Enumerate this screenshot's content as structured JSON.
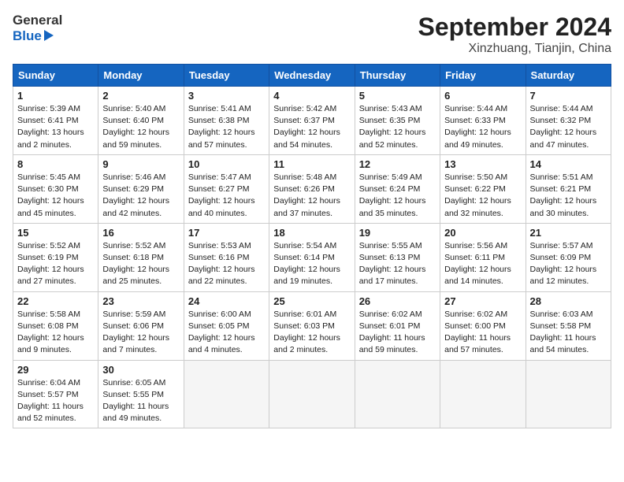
{
  "header": {
    "logo_general": "General",
    "logo_blue": "Blue",
    "title": "September 2024",
    "subtitle": "Xinzhuang, Tianjin, China"
  },
  "weekdays": [
    "Sunday",
    "Monday",
    "Tuesday",
    "Wednesday",
    "Thursday",
    "Friday",
    "Saturday"
  ],
  "weeks": [
    [
      {
        "day": "1",
        "sunrise": "5:39 AM",
        "sunset": "6:41 PM",
        "daylight": "13 hours and 2 minutes."
      },
      {
        "day": "2",
        "sunrise": "5:40 AM",
        "sunset": "6:40 PM",
        "daylight": "12 hours and 59 minutes."
      },
      {
        "day": "3",
        "sunrise": "5:41 AM",
        "sunset": "6:38 PM",
        "daylight": "12 hours and 57 minutes."
      },
      {
        "day": "4",
        "sunrise": "5:42 AM",
        "sunset": "6:37 PM",
        "daylight": "12 hours and 54 minutes."
      },
      {
        "day": "5",
        "sunrise": "5:43 AM",
        "sunset": "6:35 PM",
        "daylight": "12 hours and 52 minutes."
      },
      {
        "day": "6",
        "sunrise": "5:44 AM",
        "sunset": "6:33 PM",
        "daylight": "12 hours and 49 minutes."
      },
      {
        "day": "7",
        "sunrise": "5:44 AM",
        "sunset": "6:32 PM",
        "daylight": "12 hours and 47 minutes."
      }
    ],
    [
      {
        "day": "8",
        "sunrise": "5:45 AM",
        "sunset": "6:30 PM",
        "daylight": "12 hours and 45 minutes."
      },
      {
        "day": "9",
        "sunrise": "5:46 AM",
        "sunset": "6:29 PM",
        "daylight": "12 hours and 42 minutes."
      },
      {
        "day": "10",
        "sunrise": "5:47 AM",
        "sunset": "6:27 PM",
        "daylight": "12 hours and 40 minutes."
      },
      {
        "day": "11",
        "sunrise": "5:48 AM",
        "sunset": "6:26 PM",
        "daylight": "12 hours and 37 minutes."
      },
      {
        "day": "12",
        "sunrise": "5:49 AM",
        "sunset": "6:24 PM",
        "daylight": "12 hours and 35 minutes."
      },
      {
        "day": "13",
        "sunrise": "5:50 AM",
        "sunset": "6:22 PM",
        "daylight": "12 hours and 32 minutes."
      },
      {
        "day": "14",
        "sunrise": "5:51 AM",
        "sunset": "6:21 PM",
        "daylight": "12 hours and 30 minutes."
      }
    ],
    [
      {
        "day": "15",
        "sunrise": "5:52 AM",
        "sunset": "6:19 PM",
        "daylight": "12 hours and 27 minutes."
      },
      {
        "day": "16",
        "sunrise": "5:52 AM",
        "sunset": "6:18 PM",
        "daylight": "12 hours and 25 minutes."
      },
      {
        "day": "17",
        "sunrise": "5:53 AM",
        "sunset": "6:16 PM",
        "daylight": "12 hours and 22 minutes."
      },
      {
        "day": "18",
        "sunrise": "5:54 AM",
        "sunset": "6:14 PM",
        "daylight": "12 hours and 19 minutes."
      },
      {
        "day": "19",
        "sunrise": "5:55 AM",
        "sunset": "6:13 PM",
        "daylight": "12 hours and 17 minutes."
      },
      {
        "day": "20",
        "sunrise": "5:56 AM",
        "sunset": "6:11 PM",
        "daylight": "12 hours and 14 minutes."
      },
      {
        "day": "21",
        "sunrise": "5:57 AM",
        "sunset": "6:09 PM",
        "daylight": "12 hours and 12 minutes."
      }
    ],
    [
      {
        "day": "22",
        "sunrise": "5:58 AM",
        "sunset": "6:08 PM",
        "daylight": "12 hours and 9 minutes."
      },
      {
        "day": "23",
        "sunrise": "5:59 AM",
        "sunset": "6:06 PM",
        "daylight": "12 hours and 7 minutes."
      },
      {
        "day": "24",
        "sunrise": "6:00 AM",
        "sunset": "6:05 PM",
        "daylight": "12 hours and 4 minutes."
      },
      {
        "day": "25",
        "sunrise": "6:01 AM",
        "sunset": "6:03 PM",
        "daylight": "12 hours and 2 minutes."
      },
      {
        "day": "26",
        "sunrise": "6:02 AM",
        "sunset": "6:01 PM",
        "daylight": "11 hours and 59 minutes."
      },
      {
        "day": "27",
        "sunrise": "6:02 AM",
        "sunset": "6:00 PM",
        "daylight": "11 hours and 57 minutes."
      },
      {
        "day": "28",
        "sunrise": "6:03 AM",
        "sunset": "5:58 PM",
        "daylight": "11 hours and 54 minutes."
      }
    ],
    [
      {
        "day": "29",
        "sunrise": "6:04 AM",
        "sunset": "5:57 PM",
        "daylight": "11 hours and 52 minutes."
      },
      {
        "day": "30",
        "sunrise": "6:05 AM",
        "sunset": "5:55 PM",
        "daylight": "11 hours and 49 minutes."
      },
      null,
      null,
      null,
      null,
      null
    ]
  ],
  "labels": {
    "sunrise": "Sunrise: ",
    "sunset": "Sunset: ",
    "daylight": "Daylight: "
  }
}
